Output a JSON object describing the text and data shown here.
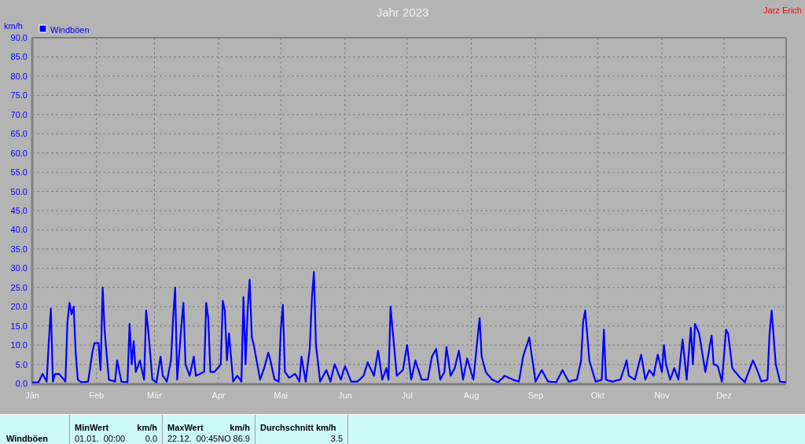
{
  "author": "Jarz Erich",
  "chart": {
    "chart_data": {
      "type": "line",
      "grid": true,
      "title": "Jahr 2023",
      "ylabel": "km/h",
      "ylim": [
        0,
        90
      ],
      "yticks": [
        {
          "value": 0,
          "label": "0.0"
        },
        {
          "value": 5,
          "label": "5.0"
        },
        {
          "value": 10,
          "label": "10.0"
        },
        {
          "value": 15,
          "label": "15.0"
        },
        {
          "value": 20,
          "label": "20.0"
        },
        {
          "value": 25,
          "label": "25.0"
        },
        {
          "value": 30,
          "label": "30.0"
        },
        {
          "value": 35,
          "label": "35.0"
        },
        {
          "value": 40,
          "label": "40.0"
        },
        {
          "value": 45,
          "label": "45.0"
        },
        {
          "value": 50,
          "label": "50.0"
        },
        {
          "value": 55,
          "label": "55.0"
        },
        {
          "value": 60,
          "label": "60.0"
        },
        {
          "value": 65,
          "label": "65.0"
        },
        {
          "value": 70,
          "label": "70.0"
        },
        {
          "value": 75,
          "label": "75.0"
        },
        {
          "value": 80,
          "label": "80.0"
        },
        {
          "value": 85,
          "label": "85.0"
        },
        {
          "value": 90,
          "label": "90.0"
        }
      ],
      "categories": [
        "Jän",
        null,
        null,
        null,
        null,
        null,
        null,
        null,
        null,
        null,
        null,
        null,
        null,
        null,
        null,
        null,
        null,
        null,
        null,
        null,
        null,
        null,
        null,
        null,
        null,
        null,
        null,
        null,
        null,
        null,
        null,
        "Feb",
        null,
        null,
        null,
        null,
        null,
        null,
        null,
        null,
        null,
        null,
        null,
        null,
        null,
        null,
        null,
        null,
        null,
        null,
        null,
        null,
        null,
        null,
        null,
        null,
        null,
        null,
        null,
        "Mär",
        null,
        null,
        null,
        null,
        null,
        null,
        null,
        null,
        null,
        null,
        null,
        null,
        null,
        null,
        null,
        null,
        null,
        null,
        null,
        null,
        null,
        null,
        null,
        null,
        null,
        null,
        null,
        null,
        null,
        null,
        "Apr",
        null,
        null,
        null,
        null,
        null,
        null,
        null,
        null,
        null,
        null,
        null,
        null,
        null,
        null,
        null,
        null,
        null,
        null,
        null,
        null,
        null,
        null,
        null,
        null,
        null,
        null,
        null,
        null,
        null,
        "Mai",
        null,
        null,
        null,
        null,
        null,
        null,
        null,
        null,
        null,
        null,
        null,
        null,
        null,
        null,
        null,
        null,
        null,
        null,
        null,
        null,
        null,
        null,
        null,
        null,
        null,
        null,
        null,
        null,
        null,
        null,
        "Jun",
        null,
        null,
        null,
        null,
        null,
        null,
        null,
        null,
        null,
        null,
        null,
        null,
        null,
        null,
        null,
        null,
        null,
        null,
        null,
        null,
        null,
        null,
        null,
        null,
        null,
        null,
        null,
        null,
        null,
        "Jul",
        null,
        null,
        null,
        null,
        null,
        null,
        null,
        null,
        null,
        null,
        null,
        null,
        null,
        null,
        null,
        null,
        null,
        null,
        null,
        null,
        null,
        null,
        null,
        null,
        null,
        null,
        null,
        null,
        null,
        null,
        "Aug",
        null,
        null,
        null,
        null,
        null,
        null,
        null,
        null,
        null,
        null,
        null,
        null,
        null,
        null,
        null,
        null,
        null,
        null,
        null,
        null,
        null,
        null,
        null,
        null,
        null,
        null,
        null,
        null,
        null,
        null,
        "Sep",
        null,
        null,
        null,
        null,
        null,
        null,
        null,
        null,
        null,
        null,
        null,
        null,
        null,
        null,
        null,
        null,
        null,
        null,
        null,
        null,
        null,
        null,
        null,
        null,
        null,
        null,
        null,
        null,
        null,
        "Okt",
        null,
        null,
        null,
        null,
        null,
        null,
        null,
        null,
        null,
        null,
        null,
        null,
        null,
        null,
        null,
        null,
        null,
        null,
        null,
        null,
        null,
        null,
        null,
        null,
        null,
        null,
        null,
        null,
        null,
        null,
        "Nov",
        null,
        null,
        null,
        null,
        null,
        null,
        null,
        null,
        null,
        null,
        null,
        null,
        null,
        null,
        null,
        null,
        null,
        null,
        null,
        null,
        null,
        null,
        null,
        null,
        null,
        null,
        null,
        null,
        null,
        "Dez",
        null,
        null,
        null,
        null,
        null,
        null,
        null,
        null,
        null,
        null,
        null,
        null,
        null,
        null,
        null,
        null,
        null,
        null,
        null,
        null,
        null,
        null,
        null,
        null,
        null,
        null,
        null,
        null,
        null,
        null
      ],
      "series": [
        {
          "name": "Windböen",
          "color": "#0000ff",
          "values": [
            0.3,
            0.3,
            0.3,
            0.3,
            1.4,
            2.5,
            1.5,
            0.5,
            11,
            19.5,
            0.5,
            2.5,
            2.5,
            2.5,
            1.8,
            1.2,
            0.5,
            16,
            21,
            18,
            20,
            8,
            1,
            0.6,
            0.3,
            0.4,
            0.4,
            0.5,
            4.3,
            8,
            10.5,
            10.5,
            10.5,
            3.5,
            25,
            13.5,
            7.3,
            1,
            0.8,
            0.7,
            0.5,
            6,
            3.3,
            0.5,
            0.4,
            0.4,
            0.3,
            15.5,
            5,
            11,
            3,
            4.5,
            6,
            3.5,
            1,
            19,
            14,
            7.5,
            1,
            0.7,
            0.3,
            3.7,
            7,
            2,
            1.3,
            0.5,
            3.3,
            6,
            17,
            25,
            1,
            8,
            15,
            21,
            5,
            3.5,
            2,
            4.5,
            7,
            2,
            2.3,
            2.5,
            2.8,
            3,
            21,
            17,
            3,
            3,
            3,
            3.7,
            4.3,
            5,
            21.5,
            19,
            6,
            13,
            6.8,
            0.5,
            1.3,
            2,
            1.3,
            0.5,
            22.5,
            5,
            19,
            27,
            12,
            10,
            7,
            4,
            1,
            2.5,
            4,
            6,
            8,
            6,
            3.5,
            1,
            0.8,
            0.5,
            14,
            20.5,
            3,
            2.3,
            1.5,
            1.8,
            2.2,
            2.5,
            1.5,
            0.5,
            7,
            3.8,
            0.5,
            4.8,
            9,
            22,
            29,
            10,
            5.3,
            0.5,
            1.5,
            2.5,
            3.5,
            2,
            0.5,
            2.8,
            5,
            3.7,
            2.3,
            1,
            2.8,
            4.5,
            3.2,
            1.8,
            0.5,
            0.5,
            0.5,
            0.5,
            1,
            1.5,
            2,
            3.8,
            5.5,
            4.3,
            3.2,
            2,
            5.3,
            8.5,
            4.8,
            1,
            2.5,
            4,
            1,
            20,
            14,
            8,
            2,
            2.5,
            3,
            3.5,
            6.8,
            10,
            5.5,
            1,
            3.5,
            6,
            4.3,
            2.7,
            1,
            1,
            1,
            1,
            4,
            7,
            8,
            9,
            5,
            1,
            2,
            3,
            9.5,
            5.8,
            2,
            3,
            4,
            6.3,
            8.5,
            4.8,
            1,
            3.8,
            6.5,
            4.7,
            2.8,
            1,
            6.3,
            11.7,
            17,
            7,
            5,
            3,
            2.3,
            1.7,
            1,
            0.8,
            0.5,
            0.3,
            0.9,
            1.4,
            2,
            1.8,
            1.5,
            1.3,
            1,
            0.8,
            0.7,
            0.5,
            3.8,
            7,
            8.7,
            10.3,
            12,
            8,
            4.3,
            0.5,
            1.5,
            2.5,
            3.5,
            2.5,
            1.5,
            0.5,
            0.5,
            0.4,
            0.4,
            0.3,
            1.4,
            2.4,
            3.5,
            2.5,
            1.5,
            0.5,
            0.6,
            0.8,
            0.9,
            1,
            3.5,
            6,
            16,
            19,
            12.5,
            6,
            4.2,
            2.3,
            0.5,
            0.7,
            0.8,
            1,
            14,
            1,
            0.8,
            0.7,
            0.5,
            0.6,
            0.8,
            0.9,
            1,
            2.7,
            4.3,
            6,
            2,
            1.7,
            1.3,
            1,
            3.2,
            5.3,
            7.5,
            4.3,
            1,
            2.3,
            3.5,
            2.8,
            2,
            4.8,
            7.5,
            5.3,
            3,
            10,
            5,
            3,
            1,
            2.5,
            4,
            2.5,
            1,
            6.3,
            11.5,
            6.3,
            1,
            7.8,
            14.5,
            5,
            15.5,
            14.3,
            13,
            9.7,
            6.3,
            3,
            6.2,
            9.3,
            12.5,
            5,
            4.8,
            4.5,
            2.5,
            0.5,
            7.3,
            14,
            13,
            8.5,
            4,
            3.3,
            2.7,
            2,
            1.4,
            0.9,
            0.3,
            1.7,
            3.2,
            4.6,
            6,
            4.8,
            3.5,
            2,
            0.5,
            0.7,
            0.8,
            1,
            13,
            19,
            12,
            5,
            2.8,
            0.5,
            0.4,
            0.4,
            0.3
          ]
        }
      ]
    }
  },
  "summary_table": {
    "row_label": "Windböen",
    "columns": [
      {
        "header": "MinWert",
        "unit": "km/h",
        "time": "01.01.  00:00",
        "value": "0.0"
      },
      {
        "header": "MaxWert",
        "unit": "km/h",
        "time": "22.12.  00:45NO",
        "value": "86.9"
      },
      {
        "header": "Durchschnitt km/h",
        "value": "3.5"
      }
    ]
  }
}
